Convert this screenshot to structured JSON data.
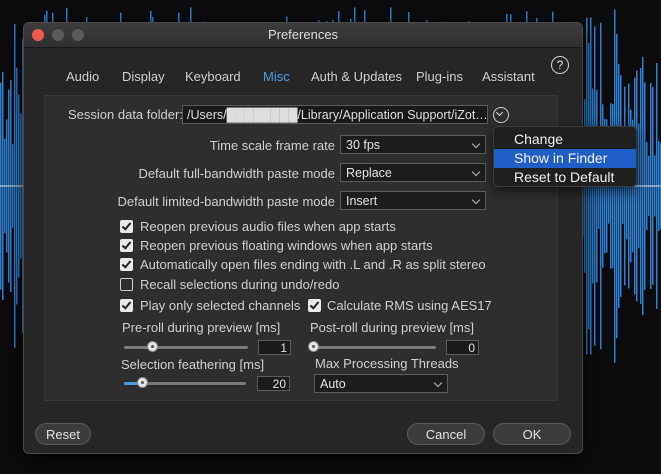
{
  "window": {
    "title": "Preferences"
  },
  "tabs": [
    {
      "label": "Audio"
    },
    {
      "label": "Display"
    },
    {
      "label": "Keyboard"
    },
    {
      "label": "Misc"
    },
    {
      "label": "Auth & Updates"
    },
    {
      "label": "Plug-ins"
    },
    {
      "label": "Assistant"
    }
  ],
  "active_tab": "Misc",
  "help_glyph": "?",
  "session": {
    "label": "Session data folder:",
    "path": "/Users/████████/Library/Application Support/iZot…"
  },
  "settings": {
    "frame_rate": {
      "label": "Time scale frame rate",
      "value": "30 fps"
    },
    "full_paste": {
      "label": "Default full-bandwidth paste mode",
      "value": "Replace"
    },
    "limited_paste": {
      "label": "Default limited-bandwidth paste mode",
      "value": "Insert"
    }
  },
  "checkboxes": {
    "reopen_audio": {
      "label": "Reopen previous audio files when app starts",
      "checked": true
    },
    "reopen_windows": {
      "label": "Reopen previous floating windows when app starts",
      "checked": true
    },
    "split_stereo": {
      "label": "Automatically open files ending with .L and .R as split stereo",
      "checked": true
    },
    "recall_selections": {
      "label": "Recall selections during undo/redo",
      "checked": false
    },
    "play_selected": {
      "label": "Play only selected channels",
      "checked": true
    },
    "rms_aes17": {
      "label": "Calculate RMS using AES17",
      "checked": true
    }
  },
  "preroll": {
    "label": "Pre-roll during preview [ms]",
    "value": "1"
  },
  "postroll": {
    "label": "Post-roll during preview [ms]",
    "value": "0"
  },
  "feathering": {
    "label": "Selection feathering [ms]",
    "value": "20"
  },
  "threads": {
    "label": "Max Processing Threads",
    "value": "Auto"
  },
  "buttons": {
    "reset": "Reset",
    "cancel": "Cancel",
    "ok": "OK"
  },
  "folder_menu": {
    "items": [
      {
        "label": "Change",
        "highlighted": false
      },
      {
        "label": "Show in Finder",
        "highlighted": true
      },
      {
        "label": "Reset to Default",
        "highlighted": false
      }
    ]
  },
  "colors": {
    "accent": "#4e9ce6",
    "menu_highlight": "#1f5ec5",
    "waveform": "#2f7fd2"
  }
}
